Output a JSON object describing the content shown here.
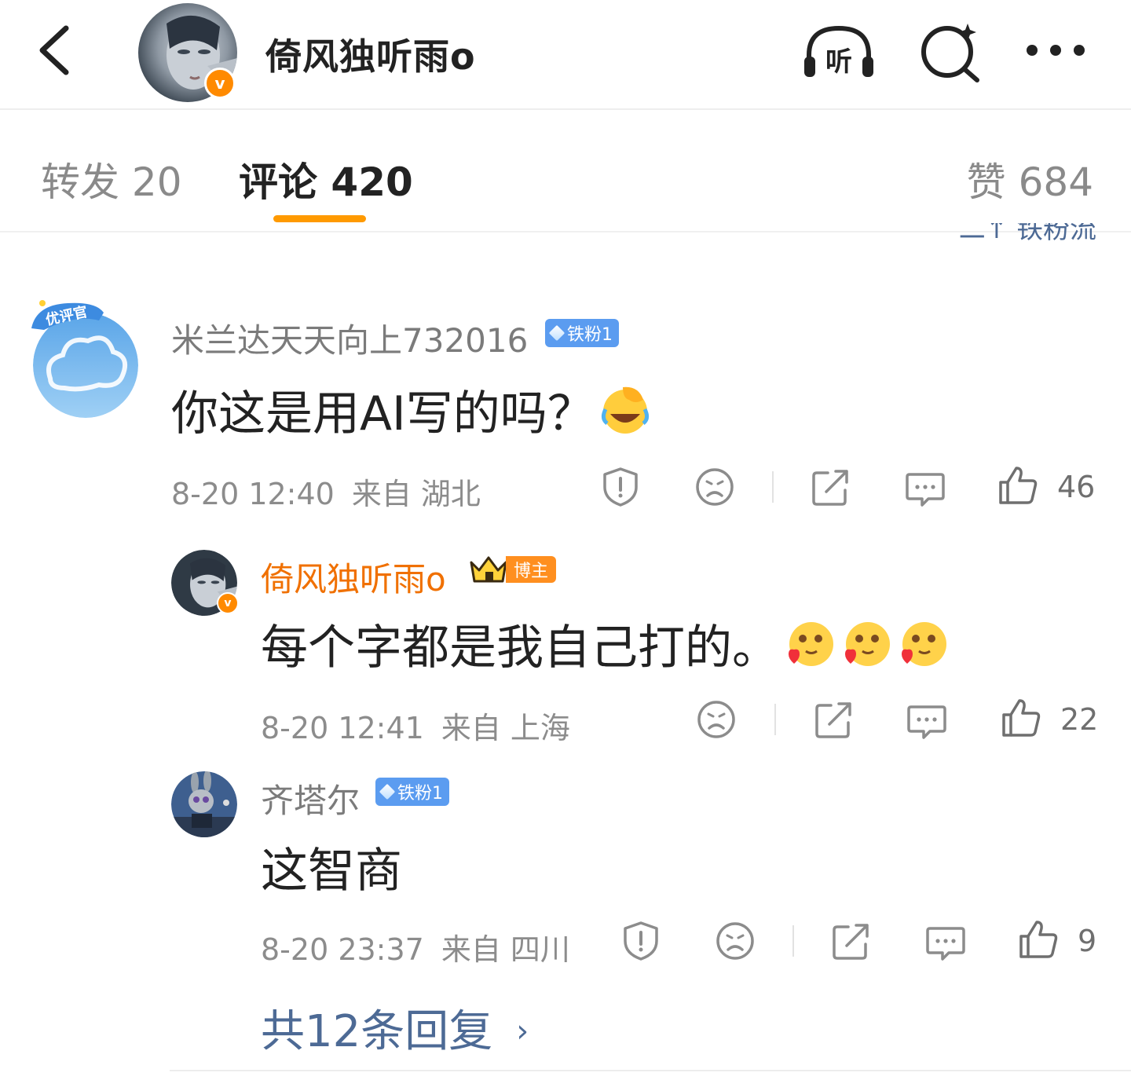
{
  "header": {
    "title": "倚风独听雨o",
    "verified_mark": "v",
    "listen_label": "听"
  },
  "tabs": {
    "repost": "转发 20",
    "comment": "评论 420",
    "like": "赞 684"
  },
  "sort": {
    "label": "二↑ 铁粉流"
  },
  "comments": [
    {
      "avatar_badge": "优评官",
      "username": "米兰达天天向上732016",
      "fan_badge": "铁粉1",
      "text": "你这是用AI写的吗？",
      "time": "8-20 12:40",
      "location": "来自 湖北",
      "likes": "46"
    },
    {
      "username": "倚风独听雨o",
      "blogger_badge": "博主",
      "verified_mark": "v",
      "text": "每个字都是我自己打的。",
      "time": "8-20 12:41",
      "location": "来自 上海",
      "likes": "22"
    },
    {
      "username": "齐塔尔",
      "fan_badge": "铁粉1",
      "text": "这智商",
      "time": "8-20 23:37",
      "location": "来自 四川",
      "likes": "9"
    }
  ],
  "more_replies": {
    "label": "共12条回复",
    "chevron": "›"
  },
  "colors": {
    "accent_orange": "#ff9a00",
    "link_blue": "#4d6a95",
    "fan_badge_blue": "#5b9cf0",
    "author_orange": "#f07000"
  }
}
